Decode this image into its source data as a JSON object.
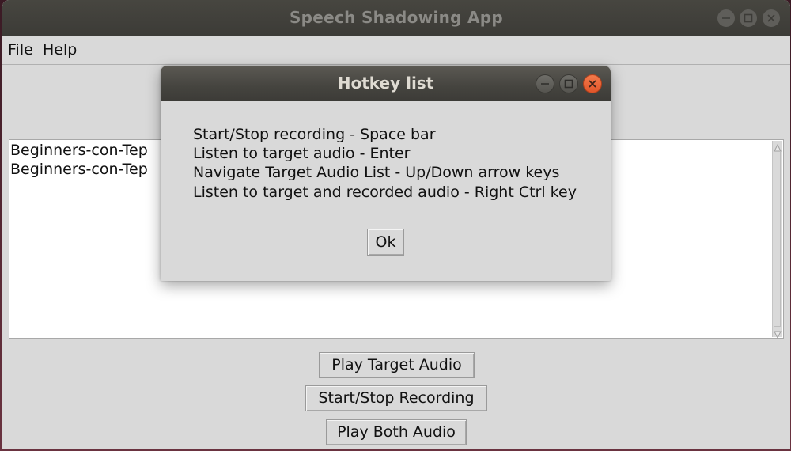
{
  "main_window": {
    "title": "Speech Shadowing App",
    "controls": {
      "minimize": "minimize-icon",
      "maximize": "maximize-icon",
      "close": "close-icon"
    }
  },
  "menubar": {
    "items": [
      {
        "label": "File"
      },
      {
        "label": "Help"
      }
    ]
  },
  "target_audio_list": {
    "items": [
      {
        "label": "Beginners-con-Tep"
      },
      {
        "label": "Beginners-con-Tep"
      }
    ]
  },
  "buttons": {
    "play_target": "Play Target Audio",
    "start_stop_recording": "Start/Stop Recording",
    "play_both": "Play Both Audio"
  },
  "dialog": {
    "title": "Hotkey list",
    "lines": [
      "Start/Stop recording - Space bar",
      "Listen to target audio - Enter",
      "Navigate Target Audio List - Up/Down arrow keys",
      "Listen to target and recorded audio - Right Ctrl key"
    ],
    "ok_label": "Ok",
    "controls": {
      "minimize": "minimize-icon",
      "maximize": "maximize-icon",
      "close": "close-icon"
    },
    "close_color": "#e95420"
  }
}
